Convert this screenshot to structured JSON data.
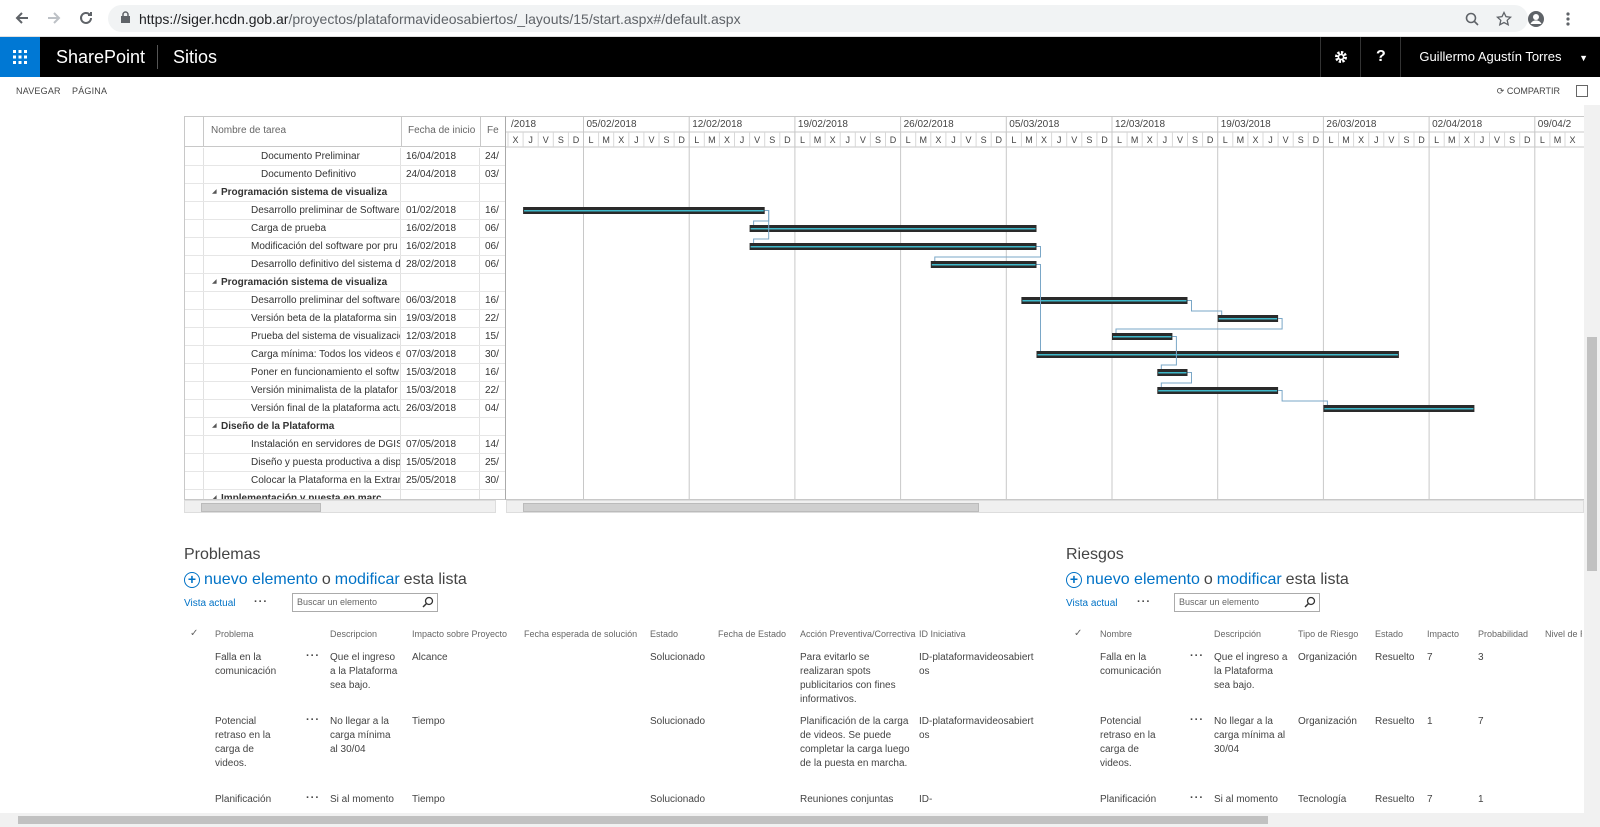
{
  "browser": {
    "url_host": "https://siger.hcdn.gob.ar",
    "url_path": "/proyectos/plataformavideosabiertos/_layouts/15/start.aspx#/default.aspx"
  },
  "suite": {
    "brand": "SharePoint",
    "section": "Sitios",
    "help": "?",
    "user": "Guillermo Agustín Torres"
  },
  "ribbon": {
    "tab_navegar": "NAVEGAR",
    "tab_pagina": "PÁGINA",
    "share": "COMPARTIR"
  },
  "gantt": {
    "col_name": "Nombre de tarea",
    "col_start": "Fecha de inicio",
    "col_end": "Fe",
    "weeks": [
      "/2018",
      "05/02/2018",
      "12/02/2018",
      "19/02/2018",
      "26/02/2018",
      "05/03/2018",
      "12/03/2018",
      "19/03/2018",
      "26/03/2018",
      "02/04/2018",
      "09/04/2"
    ],
    "days": [
      "X",
      "J",
      "V",
      "S",
      "D",
      "L",
      "M",
      "X",
      "J",
      "V",
      "S",
      "D",
      "L",
      "M",
      "X",
      "J",
      "V",
      "S",
      "D",
      "L",
      "M",
      "X",
      "J",
      "V",
      "S",
      "D",
      "L",
      "M",
      "X",
      "J",
      "V",
      "S",
      "D",
      "L",
      "M",
      "X",
      "J",
      "V",
      "S",
      "D",
      "L",
      "M",
      "X",
      "J",
      "V",
      "S",
      "D",
      "L",
      "M",
      "X",
      "J",
      "V",
      "S",
      "D",
      "L",
      "M",
      "X",
      "J",
      "V",
      "S",
      "D",
      "L",
      "M",
      "X",
      "J",
      "V",
      "S",
      "D",
      "L",
      "M",
      "X"
    ],
    "rows": [
      {
        "name": "Documento Preliminar",
        "start": "16/04/2018",
        "end": "24/",
        "indent": 2,
        "bold": false
      },
      {
        "name": "Documento Definitivo",
        "start": "24/04/2018",
        "end": "03/",
        "indent": 2,
        "bold": false
      },
      {
        "name": "Programación sistema de visualiza",
        "start": "",
        "end": "",
        "indent": 0,
        "bold": true
      },
      {
        "name": "Desarrollo preliminar de Software",
        "start": "01/02/2018",
        "end": "16/",
        "indent": 1,
        "bold": false
      },
      {
        "name": "Carga de prueba",
        "start": "16/02/2018",
        "end": "06/",
        "indent": 1,
        "bold": false
      },
      {
        "name": "Modificación del software por pru",
        "start": "16/02/2018",
        "end": "06/",
        "indent": 1,
        "bold": false
      },
      {
        "name": "Desarrollo definitivo del sistema d",
        "start": "28/02/2018",
        "end": "06/",
        "indent": 1,
        "bold": false
      },
      {
        "name": "Programación sistema de visualiza",
        "start": "",
        "end": "",
        "indent": 0,
        "bold": true
      },
      {
        "name": "Desarrollo preliminar del software",
        "start": "06/03/2018",
        "end": "16/",
        "indent": 1,
        "bold": false
      },
      {
        "name": "Versión beta de la plataforma sin",
        "start": "19/03/2018",
        "end": "22/",
        "indent": 1,
        "bold": false
      },
      {
        "name": "Prueba del sistema de visualizació",
        "start": "12/03/2018",
        "end": "15/",
        "indent": 1,
        "bold": false
      },
      {
        "name": "Carga mínima: Todos los videos es",
        "start": "07/03/2018",
        "end": "30/",
        "indent": 1,
        "bold": false
      },
      {
        "name": "Poner en funcionamiento el softw",
        "start": "15/03/2018",
        "end": "16/",
        "indent": 1,
        "bold": false
      },
      {
        "name": "Versión minimalista de la platafor",
        "start": "15/03/2018",
        "end": "22/",
        "indent": 1,
        "bold": false
      },
      {
        "name": "Versión final de la plataforma actu",
        "start": "26/03/2018",
        "end": "04/",
        "indent": 1,
        "bold": false
      },
      {
        "name": "Diseño de la Plataforma",
        "start": "",
        "end": "",
        "indent": 0,
        "bold": true
      },
      {
        "name": "Instalación en servidores de DGIS.",
        "start": "07/05/2018",
        "end": "14/",
        "indent": 1,
        "bold": false
      },
      {
        "name": "Diseño y puesta productiva a disp",
        "start": "15/05/2018",
        "end": "25/",
        "indent": 1,
        "bold": false
      },
      {
        "name": "Colocar la Plataforma en la Extran",
        "start": "25/05/2018",
        "end": "30/",
        "indent": 1,
        "bold": false
      },
      {
        "name": "Implementación y puesta en marc",
        "start": "",
        "end": "",
        "indent": 0,
        "bold": true
      }
    ]
  },
  "problemas": {
    "title": "Problemas",
    "new_label": "nuevo elemento",
    "or_label": "o",
    "modify_label": "modificar",
    "list_label": "esta lista",
    "vista": "Vista actual",
    "search_placeholder": "Buscar un elemento",
    "columns": [
      "Problema",
      "Descripcion",
      "Impacto sobre Proyecto",
      "Fecha esperada de solución",
      "Estado",
      "Fecha de Estado",
      "Acción Preventiva/Correctiva",
      "ID Iniciativa"
    ],
    "rows": [
      {
        "problema": "Falla en la comunicación",
        "descripcion": "Que el ingreso a la Plataforma sea bajo.",
        "impacto": "Alcance",
        "estado": "Solucionado",
        "accion": "Para evitarlo se realizaran spots publicitarios con fines informativos.",
        "id": "ID-plataformavideosabiertos"
      },
      {
        "problema": "Potencial retraso en la carga de videos.",
        "descripcion": "No llegar a la carga mínima al 30/04",
        "impacto": "Tiempo",
        "estado": "Solucionado",
        "accion": "Planificación de la carga de videos. Se puede completar la carga luego de la puesta en marcha.",
        "id": "ID-plataformavideosabiertos"
      },
      {
        "problema": "Planificación",
        "descripcion": "Si al momento",
        "impacto": "Tiempo",
        "estado": "Solucionado",
        "accion": "Reuniones conjuntas",
        "id": "ID-"
      }
    ]
  },
  "riesgos": {
    "title": "Riesgos",
    "new_label": "nuevo elemento",
    "or_label": "o",
    "modify_label": "modificar",
    "list_label": "esta lista",
    "vista": "Vista actual",
    "search_placeholder": "Buscar un elemento",
    "columns": [
      "Nombre",
      "Descripción",
      "Tipo de Riesgo",
      "Estado",
      "Impacto",
      "Probabilidad",
      "Nivel de Ri"
    ],
    "rows": [
      {
        "nombre": "Falla en la comunicación",
        "descripcion": "Que el ingreso a la Plataforma sea bajo.",
        "tipo": "Organización",
        "estado": "Resuelto",
        "impacto": "7",
        "probabilidad": "3"
      },
      {
        "nombre": "Potencial retraso en la carga de videos.",
        "descripcion": "No llegar a la carga mínima al 30/04",
        "tipo": "Organización",
        "estado": "Resuelto",
        "impacto": "1",
        "probabilidad": "7"
      },
      {
        "nombre": "Planificación",
        "descripcion": "Si al momento",
        "tipo": "Tecnología",
        "estado": "Resuelto",
        "impacto": "7",
        "probabilidad": "1"
      }
    ]
  }
}
